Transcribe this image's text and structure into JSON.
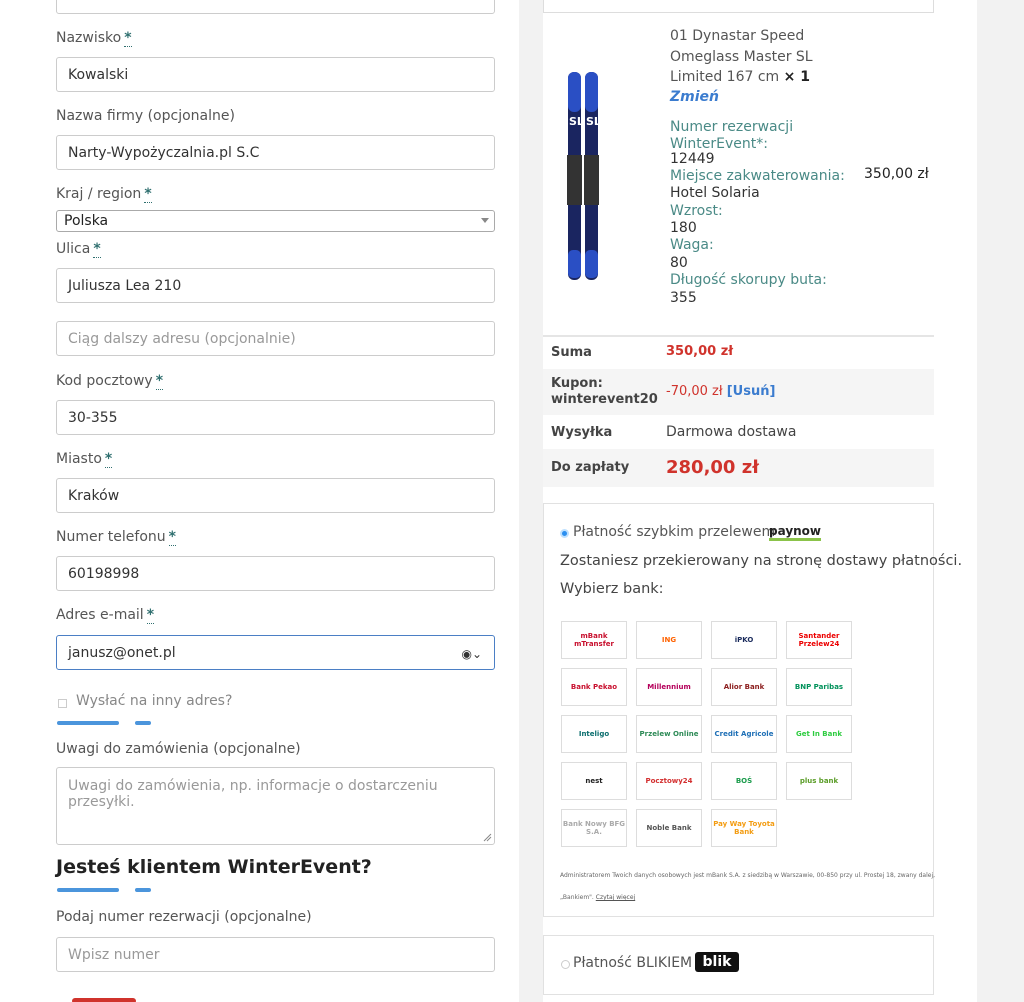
{
  "form": {
    "fields": [
      {
        "label": "Nazwisko",
        "value": "Kowalski"
      },
      {
        "label": "Nazwa firmy (opcjonalne)",
        "value": "Narty-Wypożyczalnia.pl S.C"
      },
      {
        "label": "Kraj / region",
        "value": "Polska"
      },
      {
        "label": "Ulica",
        "value": "Juliusza Lea 210"
      },
      {
        "placeholder": "Ciąg dalszy adresu (opcjonalnie)"
      },
      {
        "label": "Kod pocztowy",
        "value": "30-355"
      },
      {
        "label": "Miasto",
        "value": "Kraków"
      },
      {
        "label": "Numer telefonu",
        "value": "60198998"
      },
      {
        "label": "Adres e-mail",
        "value": "janusz@onet.pl"
      }
    ],
    "required_mark": "*",
    "ship_other": "Wysłać na inny adres?",
    "notes_label": "Uwagi do zamówienia (opcjonalne)",
    "notes_placeholder": "Uwagi do zamówienia, np. informacje o dostarczeniu przesyłki.",
    "client_heading": "Jesteś klientem WinterEvent?",
    "reservation_label": "Podaj numer rezerwacji (opcjonalne)",
    "reservation_placeholder": "Wpisz numer"
  },
  "order": {
    "product_name": "01 Dynastar Speed Omeglass Master SL Limited 167 cm",
    "qty": "× 1",
    "change": "Zmień",
    "meta": [
      {
        "k": "Numer rezerwacji WinterEvent*:",
        "v": "12449"
      },
      {
        "k": "Miejsce zakwaterowania:",
        "v": "Hotel Solaria"
      },
      {
        "k": "Wzrost:",
        "v": "180"
      },
      {
        "k": "Waga:",
        "v": "80"
      },
      {
        "k": "Długość skorupy buta:",
        "v": "355"
      }
    ],
    "line_price": "350,00 zł",
    "suma_label": "Suma",
    "suma_value": "350,00 zł",
    "coupon_label": "Kupon: winterevent20",
    "coupon_value": "-70,00 zł",
    "coupon_remove": "[Usuń]",
    "shipping_label": "Wysyłka",
    "shipping_value": "Darmowa dostawa",
    "total_label": "Do zapłaty",
    "total_value": "280,00 zł"
  },
  "payment": {
    "method1": "Płatność szybkim przelewem",
    "paynow_logo": "paynow",
    "redirect_text": "Zostaniesz przekierowany na stronę dostawy płatności.",
    "choose_bank": "Wybierz bank:",
    "banks": [
      {
        "name": "mBank mTransfer",
        "color": "#c8102e"
      },
      {
        "name": "ING",
        "color": "#ff6200"
      },
      {
        "name": "iPKO",
        "color": "#1a2b5c"
      },
      {
        "name": "Santander Przelew24",
        "color": "#ec0000"
      },
      {
        "name": "Bank Pekao",
        "color": "#c8102e"
      },
      {
        "name": "Millennium",
        "color": "#b5005b"
      },
      {
        "name": "Alior Bank",
        "color": "#8b1d1d"
      },
      {
        "name": "BNP Paribas",
        "color": "#00915a"
      },
      {
        "name": "Inteligo",
        "color": "#0b6e6e"
      },
      {
        "name": "Przelew Online",
        "color": "#2e8b57"
      },
      {
        "name": "Credit Agricole",
        "color": "#1e6fb6"
      },
      {
        "name": "Get In Bank",
        "color": "#2ecc40"
      },
      {
        "name": "nest",
        "color": "#222222"
      },
      {
        "name": "Pocztowy24",
        "color": "#d32f2f"
      },
      {
        "name": "BOŚ",
        "color": "#1a9b4b"
      },
      {
        "name": "plus bank",
        "color": "#5b9d28"
      },
      {
        "name": "Bank Nowy BFG S.A.",
        "color": "#aaaaaa"
      },
      {
        "name": "Noble Bank",
        "color": "#555555"
      },
      {
        "name": "Pay Way Toyota Bank",
        "color": "#f39c12"
      }
    ],
    "fine_print": "Administratorem Twoich danych osobowych jest mBank S.A. z siedzibą w Warszawie, 00-850 przy ul. Prostej 18, zwany dalej,",
    "fine_print2": "„Bankiem\".",
    "read_more": "Czytaj więcej",
    "method2": "Płatność BLIKIEM",
    "blik_logo": "blik"
  }
}
